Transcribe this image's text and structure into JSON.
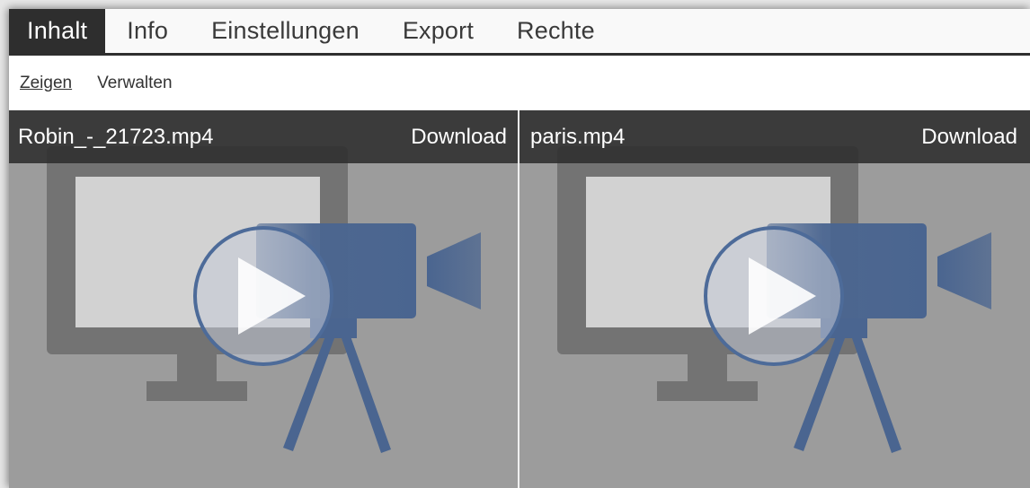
{
  "tabs": [
    {
      "label": "Inhalt",
      "active": true
    },
    {
      "label": "Info",
      "active": false
    },
    {
      "label": "Einstellungen",
      "active": false
    },
    {
      "label": "Export",
      "active": false
    },
    {
      "label": "Rechte",
      "active": false
    }
  ],
  "subnav": {
    "show_label": "Zeigen",
    "manage_label": "Verwalten"
  },
  "files": [
    {
      "name": "Robin_-_21723.mp4",
      "download_label": "Download",
      "thumbnail_icon": "video-camera-monitor-play-icon"
    },
    {
      "name": "paris.mp4",
      "download_label": "Download",
      "thumbnail_icon": "video-camera-monitor-play-icon"
    }
  ],
  "colors": {
    "tab_active_bg": "#2e2e2e",
    "card_bg": "#9c9c9c",
    "camera_blue": "#4a6590"
  }
}
